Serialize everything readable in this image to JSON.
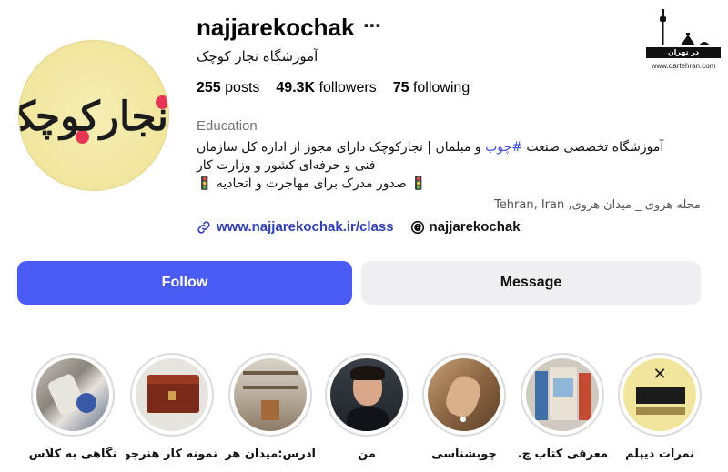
{
  "profile": {
    "username": "najjarekochak",
    "more_icon": "⋯",
    "full_name": "آموزشگاه نجار کوچک",
    "avatar_text": "نجارکوچک",
    "stats": {
      "posts_count": "255",
      "posts_label": "posts",
      "followers_count": "49.3K",
      "followers_label": "followers",
      "following_count": "75",
      "following_label": "following"
    },
    "category": "Education",
    "bio": {
      "line1_before": "آموزشگاه تخصصی صنعت ",
      "hashtag": "#چوب",
      "line1_after": " و مبلمان | نجارکوچک دارای مجوز از اداره کل سازمان",
      "line2": "فنی و حرفه‌ای کشور و وزارت کار",
      "line3": "🚦 صدور مدرک برای مهاجرت و اتحادیه 🚦"
    },
    "location": "محله هروی _ میدان هروی, Tehran, Iran",
    "website": "www.najjarekochak.ir/class",
    "threads_handle": "najjarekochak"
  },
  "actions": {
    "follow_label": "Follow",
    "message_label": "Message"
  },
  "highlights": [
    {
      "label": "نگاهی به کلاس"
    },
    {
      "label": "نمونه کار هنرجو"
    },
    {
      "label": "ادرس:میدان هر..."
    },
    {
      "label": "من"
    },
    {
      "label": "چوبشناسی"
    },
    {
      "label": "معرفی کتاب چ..."
    },
    {
      "label": "نمرات دیپلم"
    }
  ],
  "watermark": {
    "band_text": "در تهران",
    "url": "www.dartehran.com"
  },
  "colors": {
    "follow_button": "#4b5cf6",
    "message_button": "#efeff2",
    "link": "#2f3fb5",
    "hashtag": "#3f51d4",
    "category_text": "#737373"
  }
}
